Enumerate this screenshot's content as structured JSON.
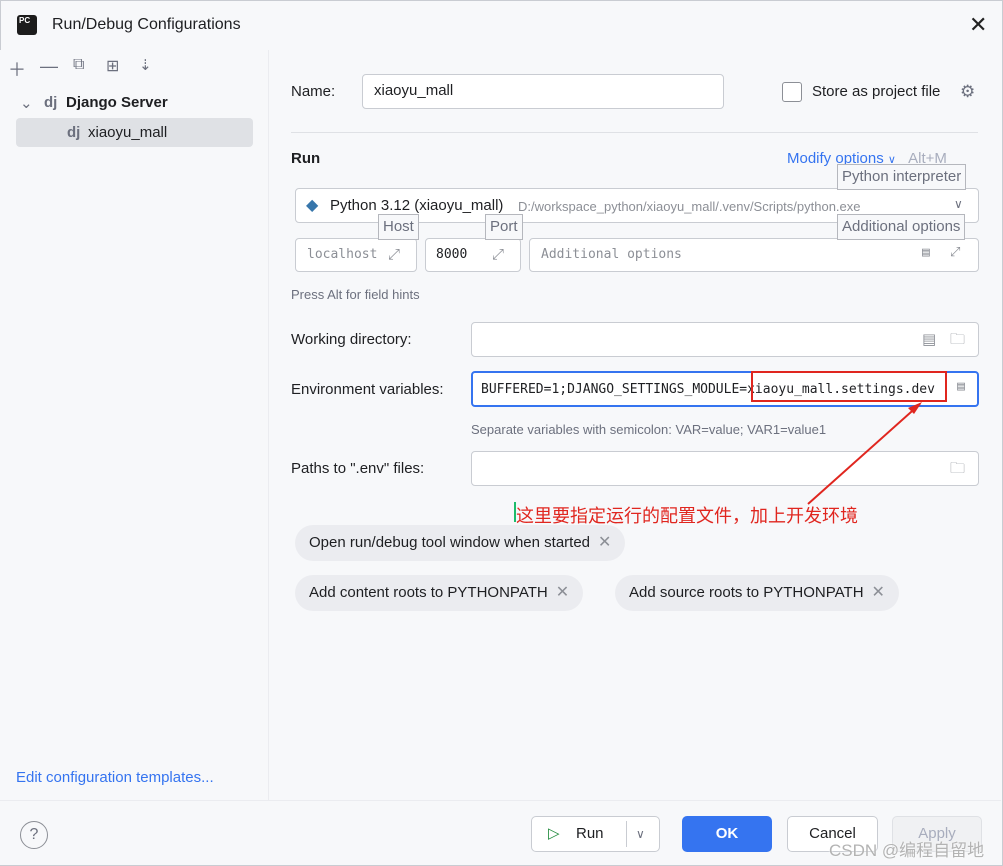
{
  "window": {
    "title": "Run/Debug Configurations"
  },
  "sidebar": {
    "toolbar": [
      "add-icon",
      "remove-icon",
      "copy-icon",
      "new-folder-icon",
      "sort-icon"
    ],
    "tree": [
      {
        "prefix": "dj",
        "label": "Django Server"
      },
      {
        "prefix": "dj",
        "label": "xiaoyu_mall"
      }
    ],
    "edit_templates": "Edit configuration templates..."
  },
  "form": {
    "name_label": "Name:",
    "name_value": "xiaoyu_mall",
    "store_project_file": "Store as project file",
    "run_section": "Run",
    "modify_options": "Modify options",
    "modify_shortcut": "Alt+M",
    "interpreter_name": "Python 3.12 (xiaoyu_mall)",
    "interpreter_path": "D:/workspace_python/xiaoyu_mall/.venv/Scripts/python.exe",
    "tip_interpreter": "Python interpreter",
    "tip_host": "Host",
    "tip_port": "Port",
    "tip_additional": "Additional options",
    "host_value": "localhost",
    "port_value": "8000",
    "additional_placeholder": "Additional options",
    "field_hint": "Press Alt for field hints",
    "workdir_label": "Working directory:",
    "env_label": "Environment variables:",
    "env_value": "BUFFERED=1;DJANGO_SETTINGS_MODULE=xiaoyu_mall.settings.dev",
    "env_hint": "Separate variables with semicolon: VAR=value; VAR1=value1",
    "envfiles_label": "Paths to \".env\" files:",
    "annotation": "这里要指定运行的配置文件，加上开发环境",
    "chips": [
      "Open run/debug tool window when started",
      "Add content roots to PYTHONPATH",
      "Add source roots to PYTHONPATH"
    ]
  },
  "footer": {
    "help": "?",
    "run": "Run",
    "ok": "OK",
    "cancel": "Cancel",
    "apply": "Apply"
  },
  "watermark": "CSDN @编程自留地"
}
